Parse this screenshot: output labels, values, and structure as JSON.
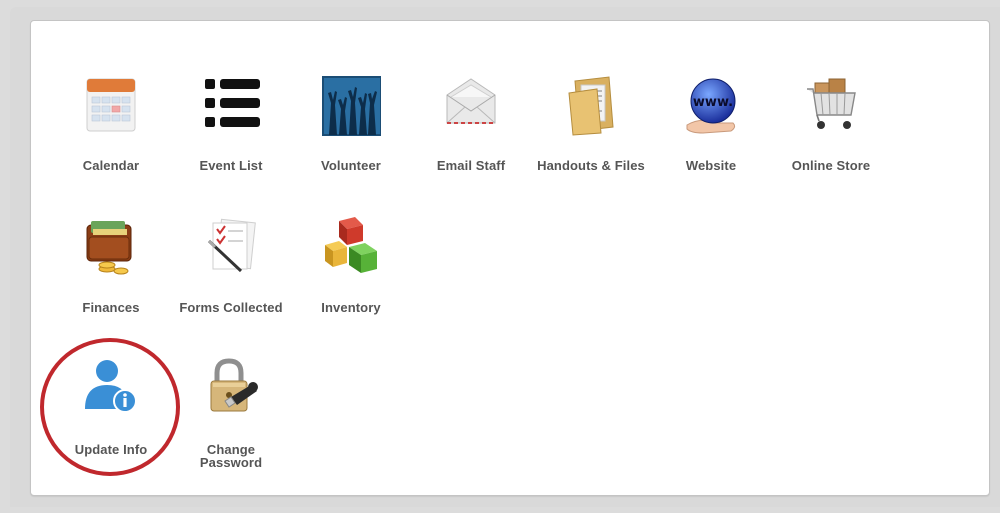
{
  "apps": {
    "calendar": {
      "label": "Calendar",
      "icon": "calendar-icon"
    },
    "event_list": {
      "label": "Event List",
      "icon": "list-icon"
    },
    "volunteer": {
      "label": "Volunteer",
      "icon": "raised-hands-icon"
    },
    "email_staff": {
      "label": "Email Staff",
      "icon": "envelope-icon"
    },
    "handouts": {
      "label": "Handouts & Files",
      "icon": "folder-icon"
    },
    "website": {
      "label": "Website",
      "icon": "globe-www-icon"
    },
    "online_store": {
      "label": "Online Store",
      "icon": "shopping-cart-icon"
    },
    "finances": {
      "label": "Finances",
      "icon": "wallet-icon"
    },
    "forms_collected": {
      "label": "Forms Collected",
      "icon": "checklist-pen-icon"
    },
    "inventory": {
      "label": "Inventory",
      "icon": "boxes-icon"
    },
    "update_info": {
      "label": "Update Info",
      "icon": "user-info-icon"
    },
    "change_password": {
      "label_line1": "Change",
      "label_line2": "Password",
      "icon": "padlock-key-icon"
    }
  },
  "highlight": {
    "target": "Update Info",
    "color": "#c0282d"
  }
}
